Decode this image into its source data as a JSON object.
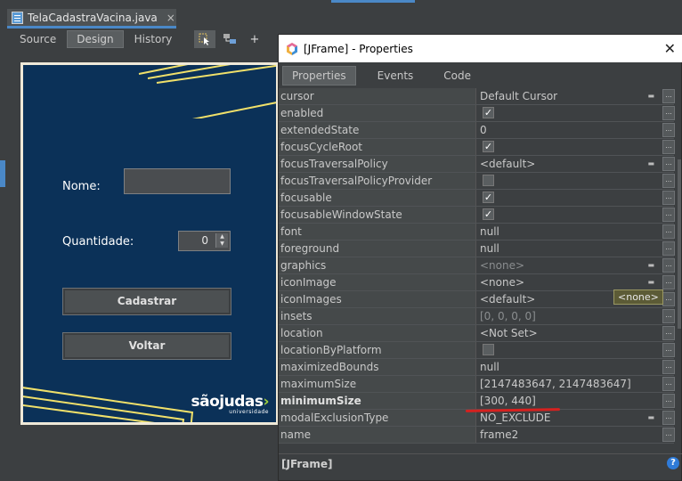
{
  "file_tab": {
    "name": "TelaCadastraVacina.java",
    "close": "×"
  },
  "editor_tabs": [
    "Source",
    "Design",
    "History"
  ],
  "toolbar": {
    "add_label": "+"
  },
  "form": {
    "nome_label": "Nome:",
    "quantidade_label": "Quantidade:",
    "quantidade_value": "0",
    "cadastrar_label": "Cadastrar",
    "voltar_label": "Voltar",
    "logo_main": "sãojudas",
    "logo_sub": "universidade",
    "bg_color": "#0b3158"
  },
  "dialog": {
    "title": "[JFrame] - Properties",
    "tabs": [
      "Properties",
      "Events",
      "Code"
    ],
    "tooltip": "<none>",
    "footer": "[JFrame]",
    "help": "?"
  },
  "properties": [
    {
      "name": "cursor",
      "value": "Default Cursor",
      "type": "dropdown"
    },
    {
      "name": "enabled",
      "value": "",
      "type": "checked"
    },
    {
      "name": "extendedState",
      "value": "0",
      "type": "text"
    },
    {
      "name": "focusCycleRoot",
      "value": "",
      "type": "checked"
    },
    {
      "name": "focusTraversalPolicy",
      "value": "<default>",
      "type": "dropdown"
    },
    {
      "name": "focusTraversalPolicyProvider",
      "value": "",
      "type": "unchecked"
    },
    {
      "name": "focusable",
      "value": "",
      "type": "checked"
    },
    {
      "name": "focusableWindowState",
      "value": "",
      "type": "checked"
    },
    {
      "name": "font",
      "value": "null",
      "type": "text"
    },
    {
      "name": "foreground",
      "value": "null",
      "type": "text"
    },
    {
      "name": "graphics",
      "value": "<none>",
      "type": "dimdropdown"
    },
    {
      "name": "iconImage",
      "value": "<none>",
      "type": "dropdown"
    },
    {
      "name": "iconImages",
      "value": "<default>",
      "type": "text"
    },
    {
      "name": "insets",
      "value": "[0, 0, 0, 0]",
      "type": "dim"
    },
    {
      "name": "location",
      "value": "<Not Set>",
      "type": "text"
    },
    {
      "name": "locationByPlatform",
      "value": "",
      "type": "unchecked"
    },
    {
      "name": "maximizedBounds",
      "value": "null",
      "type": "text"
    },
    {
      "name": "maximumSize",
      "value": "[2147483647, 2147483647]",
      "type": "text"
    },
    {
      "name": "minimumSize",
      "value": "[300, 440]",
      "type": "text",
      "bold": true
    },
    {
      "name": "modalExclusionType",
      "value": "NO_EXCLUDE",
      "type": "dropdown"
    },
    {
      "name": "name",
      "value": "frame2",
      "type": "text"
    }
  ]
}
